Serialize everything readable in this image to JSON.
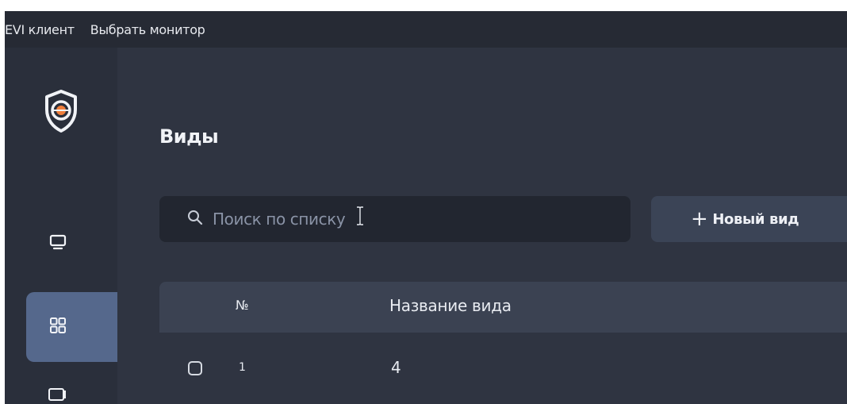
{
  "menubar": {
    "app_name": "EVI клиент",
    "select_monitor": "Выбрать монитор"
  },
  "sidebar": {
    "items": [
      {
        "icon": "monitor-icon"
      },
      {
        "icon": "grid-icon",
        "active": true
      },
      {
        "icon": "layout-icon"
      }
    ]
  },
  "page": {
    "title": "Виды"
  },
  "search": {
    "placeholder": "Поиск по списку"
  },
  "toolbar": {
    "new_view_label": "Новый вид"
  },
  "table": {
    "columns": [
      "№",
      "Название вида"
    ],
    "rows": [
      {
        "num": "1",
        "name": "4"
      }
    ]
  },
  "colors": {
    "background": "#2f3441",
    "sidebar": "#2a2f3b",
    "menubar": "#262a34",
    "active_nav": "#55688c",
    "accent": "#f07f3c"
  }
}
